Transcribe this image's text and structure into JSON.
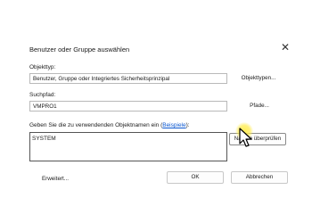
{
  "dialog": {
    "title": "Benutzer oder Gruppe auswählen",
    "object_type_label": "Objekttyp:",
    "object_type_value": "Benutzer, Gruppe oder Integriertes Sicherheitsprinzipal",
    "object_types_button": "Objekttypen...",
    "search_path_label": "Suchpfad:",
    "search_path_value": "VMPRO1",
    "paths_button": "Pfade...",
    "names_label_prefix": "Geben Sie die zu verwendenden Objektnamen ein (",
    "names_label_link": "Beispiele",
    "names_label_suffix": "):",
    "names_value": "SYSTEM",
    "check_names_button": "Namen überprüfen",
    "advanced_button": "Erweitert...",
    "ok_button": "OK",
    "cancel_button": "Abbrechen"
  },
  "icons": {
    "close": "close-icon",
    "pointer": "mouse-pointer-icon"
  },
  "colors": {
    "link": "#0b57d0",
    "highlight": "#ffec50"
  }
}
